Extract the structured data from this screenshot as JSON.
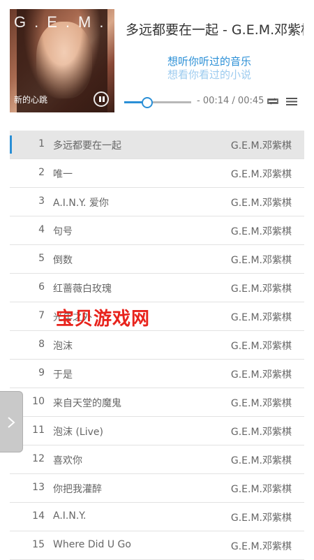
{
  "player": {
    "cover": {
      "brand_text": "G.E.M.",
      "album_label": "新的心跳"
    },
    "song_title": "多远都要在一起 - G.E.M.邓紫棋",
    "lyrics": [
      "想听你听过的音乐",
      "想看你看过的小说"
    ],
    "progress": {
      "fraction": 0.33,
      "time_text": "- 00:14 / 00:45"
    },
    "icons": {
      "pause": "pause-icon",
      "repeat": "repeat-icon",
      "menu": "menu-icon"
    }
  },
  "playlist": [
    {
      "num": "1",
      "title": "多远都要在一起",
      "artist": "G.E.M.邓紫棋",
      "active": true
    },
    {
      "num": "2",
      "title": "唯一",
      "artist": "G.E.M.邓紫棋"
    },
    {
      "num": "3",
      "title": "A.I.N.Y. 爱你",
      "artist": "G.E.M.邓紫棋"
    },
    {
      "num": "4",
      "title": "句号",
      "artist": "G.E.M.邓紫棋"
    },
    {
      "num": "5",
      "title": "倒数",
      "artist": "G.E.M.邓紫棋"
    },
    {
      "num": "6",
      "title": "红蔷薇白玫瑰",
      "artist": "G.E.M.邓紫棋"
    },
    {
      "num": "7",
      "title": "光年之外",
      "artist": "G.E.M.邓紫棋"
    },
    {
      "num": "8",
      "title": "泡沫",
      "artist": "G.E.M.邓紫棋"
    },
    {
      "num": "9",
      "title": "于是",
      "artist": "G.E.M.邓紫棋"
    },
    {
      "num": "10",
      "title": "来自天堂的魔鬼",
      "artist": "G.E.M.邓紫棋"
    },
    {
      "num": "11",
      "title": "泡沫 (Live)",
      "artist": "G.E.M.邓紫棋"
    },
    {
      "num": "12",
      "title": "喜欢你",
      "artist": "G.E.M.邓紫棋"
    },
    {
      "num": "13",
      "title": "你把我灌醉",
      "artist": "G.E.M.邓紫棋"
    },
    {
      "num": "14",
      "title": "A.I.N.Y.",
      "artist": "G.E.M.邓紫棋"
    },
    {
      "num": "15",
      "title": "Where Did U Go",
      "artist": "G.E.M.邓紫棋"
    }
  ],
  "watermark": "宝贝游戏网",
  "colors": {
    "accent": "#2a8fd6",
    "active_row": "#e6e6e6",
    "watermark": "#e8231c"
  }
}
